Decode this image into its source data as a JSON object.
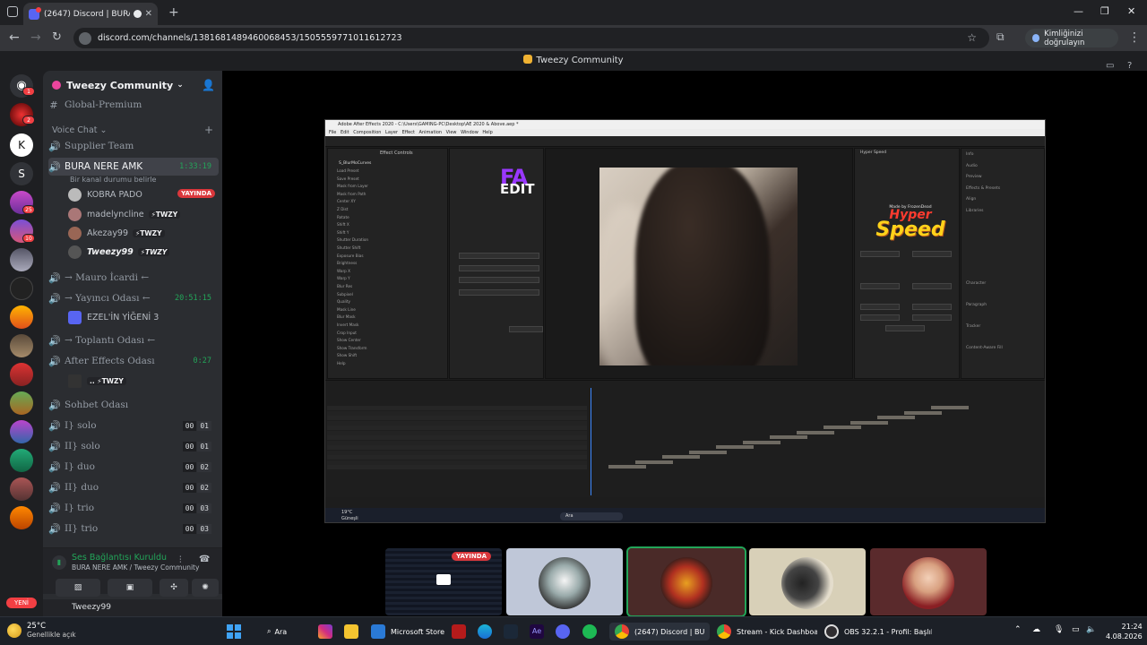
{
  "browser": {
    "tab_title": "(2647) Discord | BURA NERE",
    "new_tab": "+",
    "url": "discord.com/channels/1381681489460068453/1505559771011612723",
    "verify_label": "Kimliğinizi doğrulayın",
    "window_controls": [
      "—",
      "❐",
      "✕"
    ]
  },
  "discord": {
    "top_title": "Tweezy Community",
    "guild_name": "Tweezy Community",
    "global_channel": "Global-Premium",
    "voice_chat_header": "Voice Chat",
    "channels": [
      {
        "name": "Supplier Team",
        "type": "voice",
        "emoji": "🐵"
      },
      {
        "name": "BURA NERE AMK",
        "type": "voice",
        "time": "1:33:19",
        "active": true
      },
      {
        "name": "→ Mauro İcardi ←",
        "type": "voice"
      },
      {
        "name": "→ Yayıncı Odası ←",
        "type": "voice",
        "time": "20:51:15"
      },
      {
        "name": "→ Toplantı Odası ←",
        "type": "voice"
      },
      {
        "name": "After Effects Odası",
        "type": "voice",
        "time": "0:27"
      },
      {
        "name": "Sohbet Odası",
        "type": "voice"
      },
      {
        "name": "I} solo",
        "type": "voice",
        "count": [
          "00",
          "01"
        ]
      },
      {
        "name": "II} solo",
        "type": "voice",
        "count": [
          "00",
          "01"
        ]
      },
      {
        "name": "I} duo",
        "type": "voice",
        "count": [
          "00",
          "02"
        ]
      },
      {
        "name": "II} duo",
        "type": "voice",
        "count": [
          "00",
          "02"
        ]
      },
      {
        "name": "I} trio",
        "type": "voice",
        "count": [
          "00",
          "03"
        ]
      },
      {
        "name": "II} trio",
        "type": "voice",
        "count": [
          "00",
          "03"
        ]
      }
    ],
    "channel_status": "Bir kanal durumu belirle",
    "members": [
      {
        "name": "KOBRA PADO",
        "live": "YAYINDA"
      },
      {
        "name": "madelyncline",
        "tag": "⚡TWZY"
      },
      {
        "name": "Akezay99",
        "tag": "⚡TWZY"
      },
      {
        "name": "Tweezy99",
        "tag": "⚡TWZY"
      }
    ],
    "yayinci_member": "EZEL'İN YİĞENİ 3",
    "ae_member": ".. ⚡TWZY",
    "voice_panel": {
      "connected": "Ses Bağlantısı Kuruldu",
      "sub": "BURA NERE AMK / Tweezy Community"
    },
    "user_panel_name": "Tweezy99",
    "new_badge": "YENİ",
    "server_badges": [
      "1",
      "2",
      "25",
      "10"
    ],
    "tile_live_badge": "YAYINDA"
  },
  "after_effects": {
    "window_title": "Adobe After Effects 2020 - C:\\Users\\GAMING-PC\\Desktop\\AE 2020 & Above.aep *",
    "menu": "File  Edit  Composition  Layer  Effect  Animation  View  Window  Help",
    "effect_controls_tab": "Effect Controls",
    "fx_name": "S_BlurMoCurves",
    "fa_text": "FA",
    "edit_text": "EDIT",
    "made_by": "Made by FrozenDead",
    "hyper_text": "Hyper",
    "speed_text": "Speed",
    "panel_right_title": "Hyper Speed",
    "fx_rows": [
      "Load Preset",
      "Save Preset",
      "Mask from Layer",
      "Mask from Path",
      "Center XY",
      "Z Dist",
      "Rotate",
      "Shift X",
      "Shift Y",
      "Shutter Duration",
      "Shutter Shift",
      "Exposure Bias",
      "Brightness",
      "Warp X",
      "Warp Y",
      "Blur Res",
      "Subpixel",
      "Quality",
      "Mask Line",
      "Blur Mask",
      "Invert Mask",
      "Crop Input",
      "Show Center",
      "Show Transform",
      "Show Shift",
      "Help"
    ],
    "right_panel": [
      "Info",
      "Audio",
      "Preview",
      "Effects & Presets",
      "Align",
      "Libraries",
      "Character",
      "Paragraph",
      "Tracker",
      "Content-Aware Fill"
    ],
    "taskbar_temp": "19°C",
    "taskbar_weather": "Güneşli",
    "taskbar_search": "Ara"
  },
  "taskbar": {
    "weather_temp": "25°C",
    "weather_desc": "Genellikle açık",
    "search": "Ara",
    "items": [
      "Microsoft Store",
      "(2647) Discord | BURA N",
      "Stream - Kick Dashboar",
      "OBS 32.2.1 - Profil: Başlıl"
    ],
    "time": "21:24",
    "date": "4.08.2026"
  },
  "colors": {
    "accent_green": "#23a559",
    "live_red": "#da373c",
    "discord_blurple": "#5865f2"
  }
}
